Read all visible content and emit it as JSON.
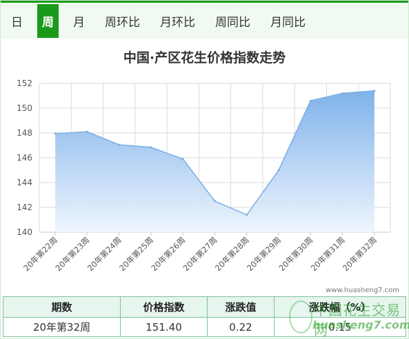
{
  "tabs": [
    "日",
    "周",
    "月",
    "周环比",
    "月环比",
    "周同比",
    "月同比"
  ],
  "active_tab": 1,
  "chart_data": {
    "type": "area",
    "title": "中国·产区花生价格指数走势",
    "categories": [
      "20年第22周",
      "20年第23周",
      "20年第24周",
      "20年第25周",
      "20年第26周",
      "20年第27周",
      "20年第28周",
      "20年第29周",
      "20年第30周",
      "20年第31周",
      "20年第32周"
    ],
    "values": [
      147.95,
      148.1,
      147.05,
      146.85,
      145.9,
      142.5,
      141.4,
      145.0,
      150.6,
      151.2,
      151.4
    ],
    "ylim": [
      140,
      152
    ],
    "yticks": [
      140,
      142,
      144,
      146,
      148,
      150,
      152
    ],
    "grid": true,
    "colors": {
      "line": "#7aaee6",
      "fill_top": "#7fb2ea",
      "fill_bottom": "#eef5fd"
    }
  },
  "watermark": {
    "url": "www.huasheng7.com",
    "logo_text": "中国花生交易网",
    "logo_url": "huasheng7.com"
  },
  "summary": {
    "headers": [
      "期数",
      "价格指数",
      "涨跌值",
      "涨跌幅（%）"
    ],
    "row": [
      "20年第32周",
      "151.40",
      "0.22",
      "0.15"
    ]
  }
}
